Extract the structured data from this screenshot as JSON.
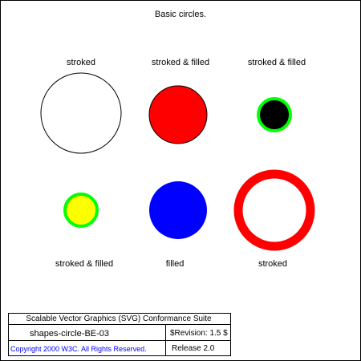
{
  "title": "Basic circles.",
  "labels": {
    "top_left": "stroked",
    "top_middle": "stroked & filled",
    "top_right": "stroked & filled",
    "bottom_left": "stroked & filled",
    "bottom_middle": "filled",
    "bottom_right": "stroked"
  },
  "circles": [
    {
      "id": "white-circle",
      "fill": "#ffffff",
      "stroke": "#000000"
    },
    {
      "id": "red-circle",
      "fill": "#ff0000",
      "stroke": "#000000"
    },
    {
      "id": "black-circle",
      "fill": "#000000",
      "stroke": "#00ff00"
    },
    {
      "id": "yellow-circle",
      "fill": "#ffff00",
      "stroke": "#00ff00"
    },
    {
      "id": "blue-circle",
      "fill": "#0000ff",
      "stroke": "none"
    },
    {
      "id": "ring-circle",
      "fill": "none",
      "stroke": "#ff0000"
    }
  ],
  "legend": {
    "suite": "Scalable Vector Graphics (SVG) Conformance Suite",
    "test_id": "shapes-circle-BE-03",
    "revision": "$Revision: 1.5 $",
    "copyright": "Copyright 2000 W3C. All Rights Reserved.",
    "release": "Release 2.0",
    "copyright_color": "#0000ff"
  }
}
